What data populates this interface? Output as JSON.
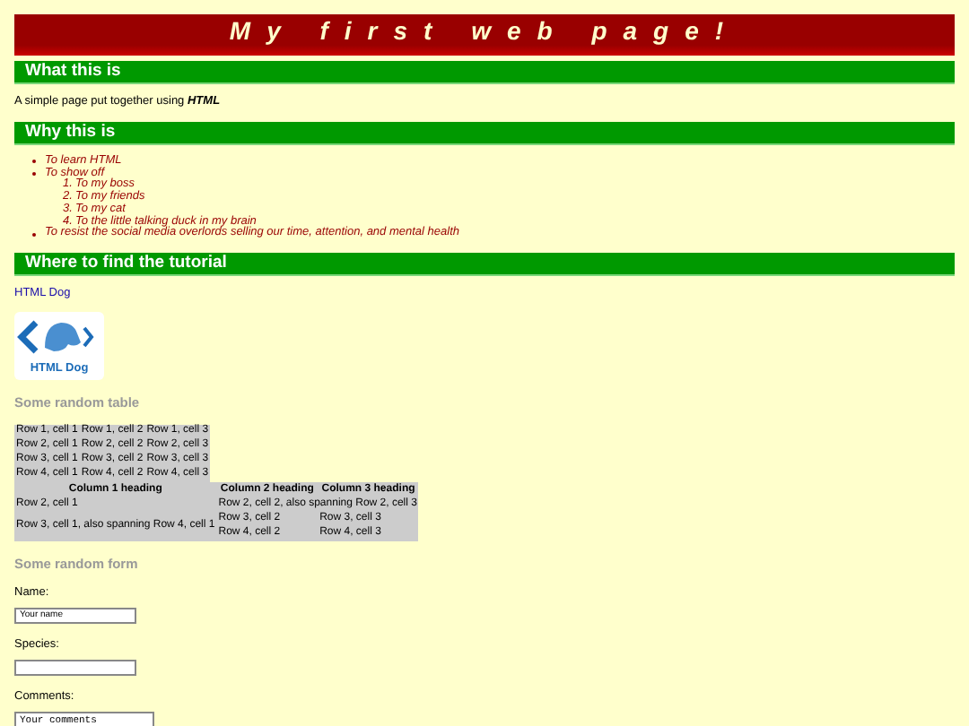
{
  "title": "My first web page!",
  "sections": [
    {
      "heading": "What this is",
      "kind": "paragraph",
      "text": "A simple page put together using **HTML**"
    },
    {
      "heading": "Why this is",
      "kind": "list",
      "items": [
        {
          "text": "To learn HTML"
        },
        {
          "text": "To show off",
          "children": [
            {
              "marker": "1.",
              "text": "To my boss"
            },
            {
              "marker": "2.",
              "text": "To my friends"
            },
            {
              "marker": "3.",
              "text": "To my cat"
            },
            {
              "marker": "4.",
              "text": "To the little talking duck in my brain"
            }
          ]
        },
        {
          "text": "To resist the social media overlords selling our time, attention, and mental health"
        }
      ]
    },
    {
      "heading": "Where to find the tutorial",
      "kind": "links",
      "link": "HTML Dog",
      "logo_text": "HTML Dog"
    }
  ],
  "table_heading": "Some random table",
  "table1": [
    [
      "Row 1, cell 1",
      "Row 1, cell 2",
      "Row 1, cell 3"
    ],
    [
      "Row 2, cell 1",
      "Row 2, cell 2",
      "Row 2, cell 3"
    ],
    [
      "Row 3, cell 1",
      "Row 3, cell 2",
      "Row 3, cell 3"
    ],
    [
      "Row 4, cell 1",
      "Row 4, cell 2",
      "Row 4, cell 3"
    ]
  ],
  "table2": {
    "columns": [
      "Column 1 heading",
      "Column 2 heading",
      "Column 3 heading"
    ],
    "row2": [
      "Row 2, cell 1",
      "Row 2, cell 2, also spanning Row 2, cell 3"
    ],
    "row3": [
      "Row 3, cell 1, also spanning Row 4, cell 1",
      "Row 3, cell 2",
      "Row 3, cell 3"
    ],
    "row4": [
      "Row 4, cell 2",
      "Row 4, cell 3"
    ]
  },
  "form_heading": "Some random form",
  "form": [
    {
      "label": "Name:",
      "kind": "input",
      "value": "Your name"
    },
    {
      "label": "Species:",
      "kind": "input"
    },
    {
      "label": "Comments:",
      "kind": "textarea",
      "value": "Your comments"
    }
  ]
}
